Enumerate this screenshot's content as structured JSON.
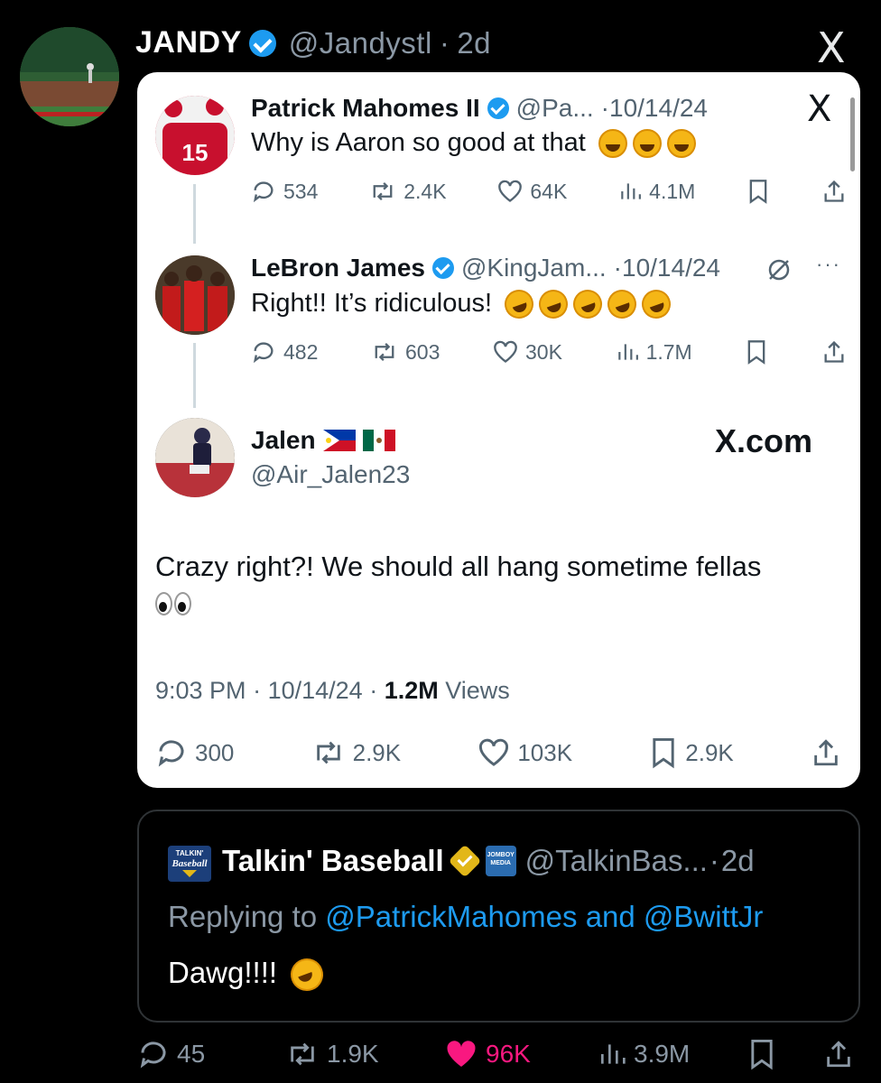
{
  "outer": {
    "display_name": "JANDY",
    "handle": "@Jandystl",
    "time": "2d",
    "x_logo": "X",
    "avatar_icon": "baseball-field-avatar"
  },
  "card": {
    "x_logo": "X",
    "tweets": [
      {
        "name": "Patrick Mahomes II",
        "handle": "@Pa...",
        "date": "10/14/24",
        "text": "Why is Aaron so good at that",
        "emoji": "joy",
        "emoji_count": 3,
        "replies": "534",
        "reposts": "2.4K",
        "likes": "64K",
        "views": "4.1M"
      },
      {
        "name": "LeBron James",
        "handle": "@KingJam...",
        "date": "10/14/24",
        "text": "Right!! It’s ridiculous!",
        "emoji": "rofl",
        "emoji_count": 5,
        "replies": "482",
        "reposts": "603",
        "likes": "30K",
        "views": "1.7M"
      }
    ],
    "main": {
      "name": "Jalen",
      "handle": "@Air_Jalen23",
      "source": "X.com",
      "text": "Crazy right?! We should all hang sometime fellas",
      "emoji": "eyes",
      "time": "9:03 PM",
      "date": "10/14/24",
      "views_count": "1.2M",
      "views_label": "Views",
      "replies": "300",
      "reposts": "2.9K",
      "likes": "103K",
      "bookmarks": "2.9K"
    }
  },
  "reply": {
    "name": "Talkin' Baseball",
    "handle": "@TalkinBas...",
    "time": "2d",
    "replying_prefix": "Replying to",
    "replying_to": "@PatrickMahomes and @BwittJr",
    "text": "Dawg!!!!",
    "emoji": "rofl",
    "logo_text_1": "TALKIN'",
    "logo_text_2": "Baseball",
    "badge_text_1": "JOMBOY",
    "badge_text_2": "MEDIA"
  },
  "actions": {
    "replies": "45",
    "reposts": "1.9K",
    "likes": "96K",
    "views": "3.9M"
  },
  "colors": {
    "accent": "#1d9bf0",
    "like": "#f91880",
    "muted_dark": "#8b98a5",
    "muted_light": "#536471",
    "gold": "#e2b719"
  }
}
